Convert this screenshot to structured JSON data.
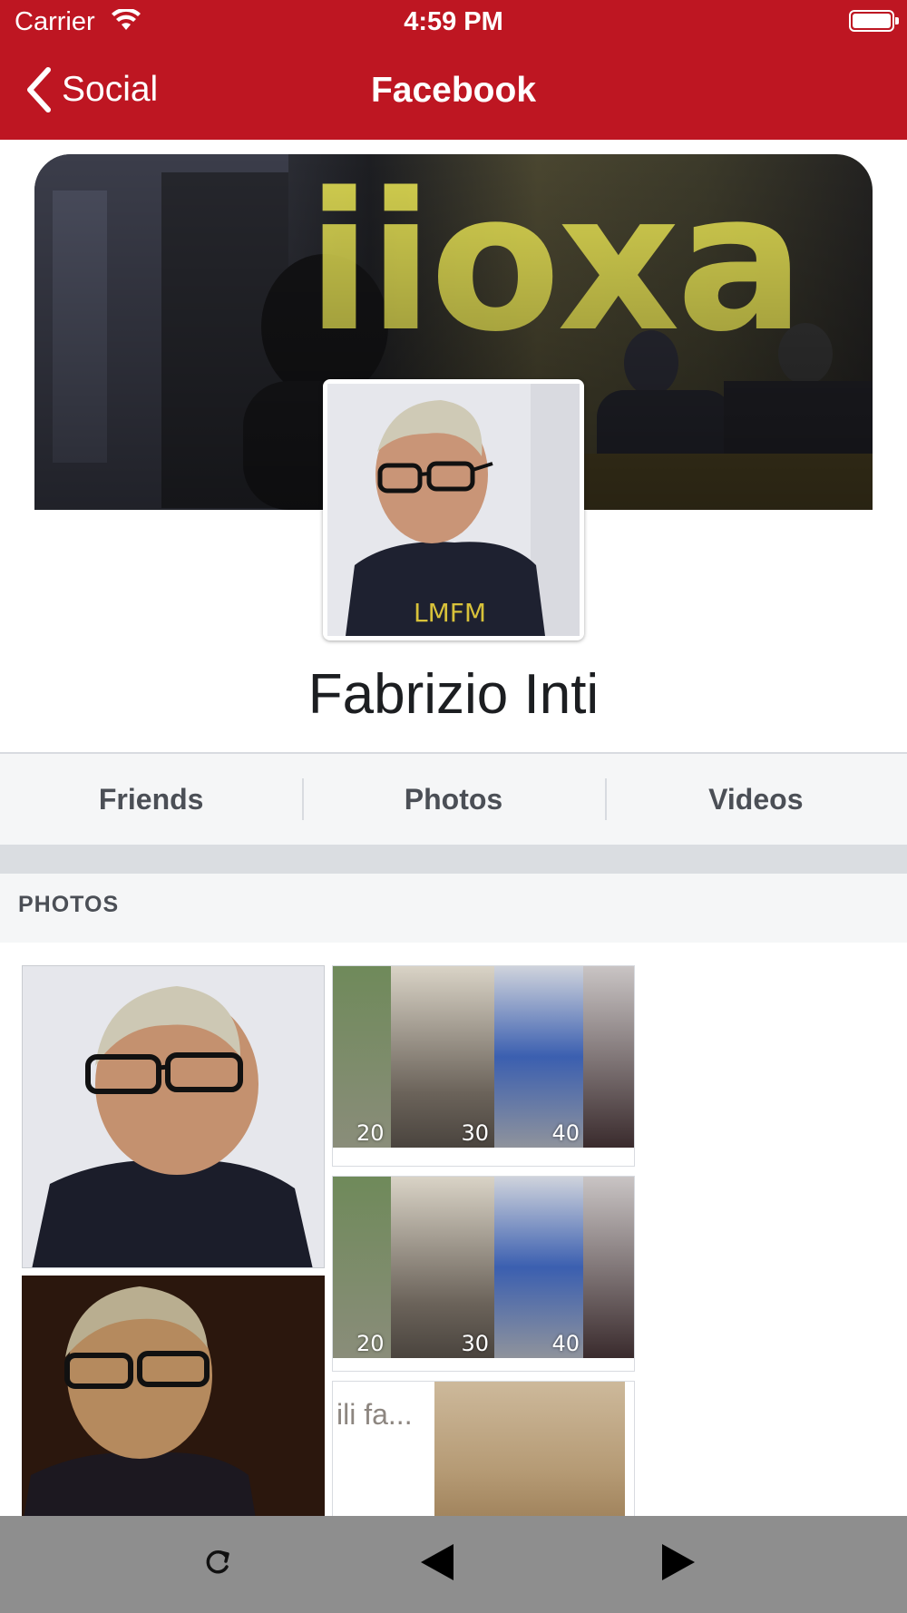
{
  "status_bar": {
    "carrier": "Carrier",
    "time": "4:59 PM"
  },
  "nav": {
    "back_label": "Social",
    "title": "Facebook"
  },
  "profile": {
    "name": "Fabrizio Inti",
    "cover_sign_text": "iioxa"
  },
  "tabs": [
    {
      "label": "Friends"
    },
    {
      "label": "Photos"
    },
    {
      "label": "Videos"
    }
  ],
  "section": {
    "label": "PHOTOS"
  },
  "collage_numbers": [
    "20",
    "30",
    "40"
  ],
  "photo_caption": "ili fa...",
  "toolbar": {
    "icons": [
      "refresh-icon",
      "back-arrow-icon",
      "forward-arrow-icon"
    ]
  },
  "colors": {
    "brand": "#be1622",
    "toolbar": "#8e8e8e"
  }
}
